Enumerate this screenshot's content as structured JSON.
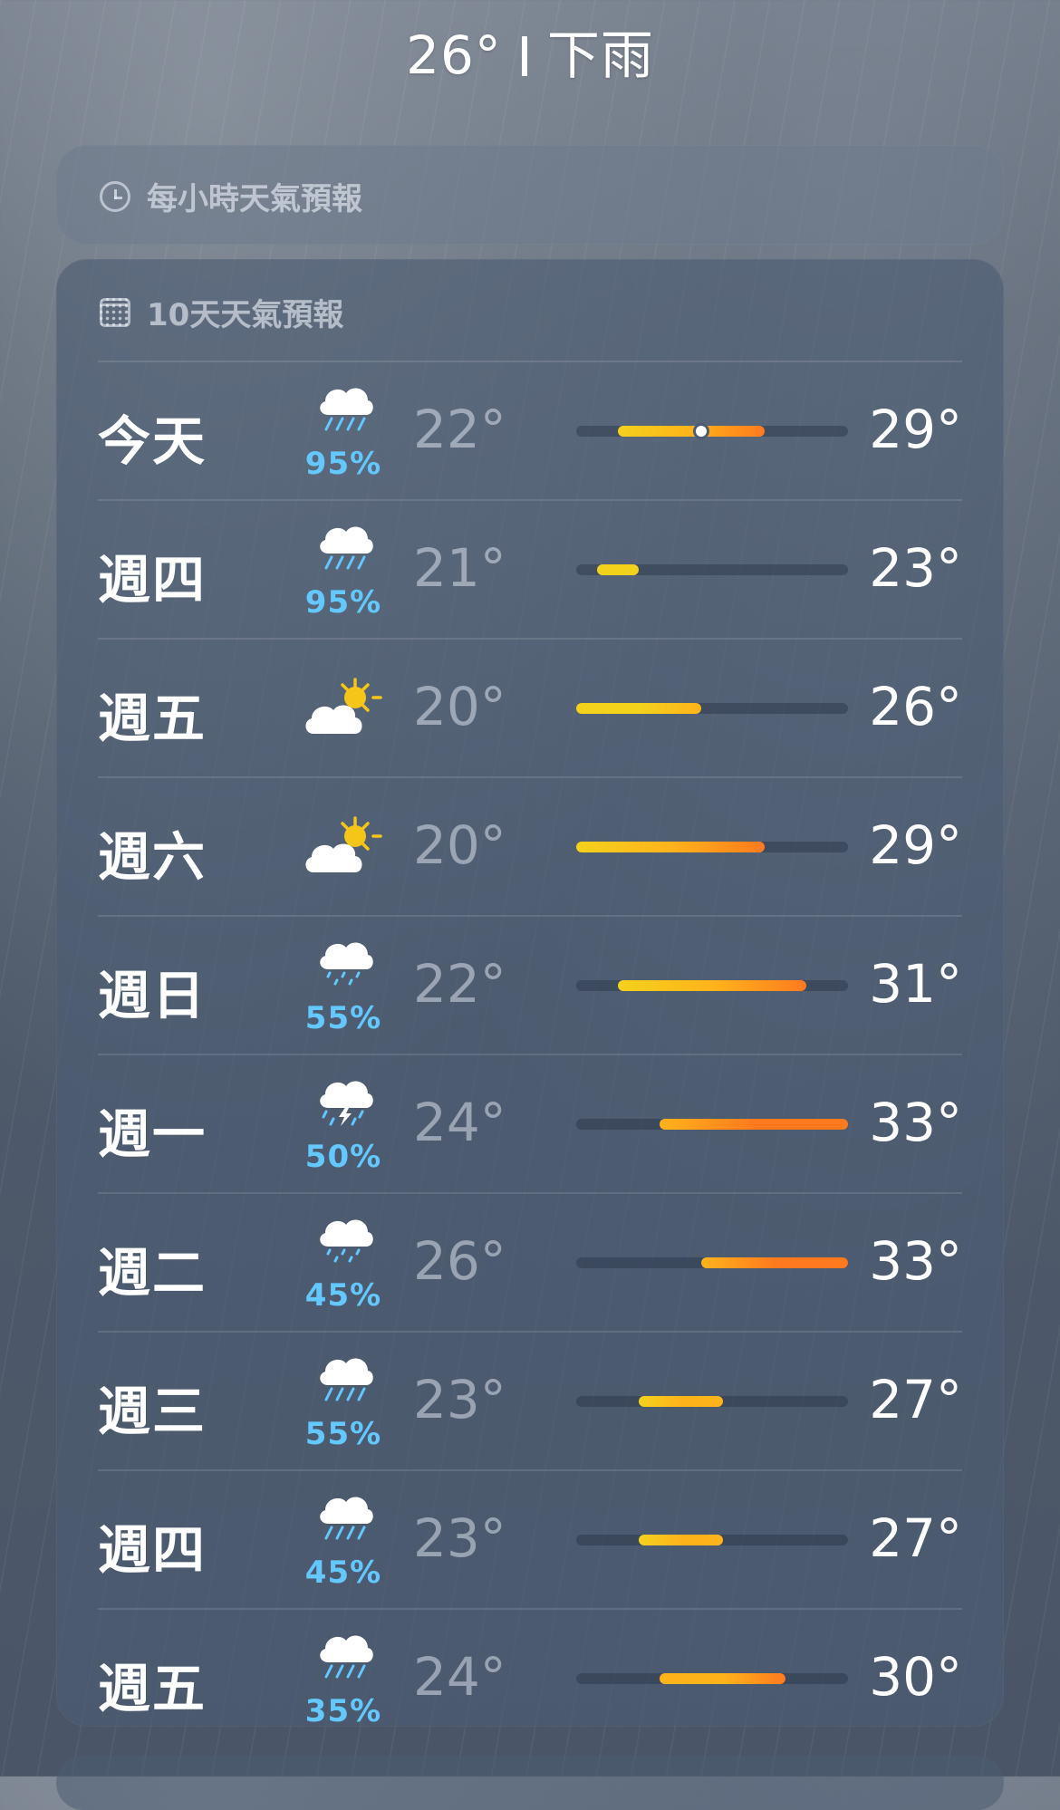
{
  "header": {
    "temperature": "26°",
    "condition": "下雨"
  },
  "hourly": {
    "label": "每小時天氣預報",
    "icon": "clock-icon"
  },
  "ten_day": {
    "label": "10天天氣預報",
    "icon": "calendar-icon",
    "scale_min": 20,
    "scale_max": 33,
    "current_temperature": 26,
    "rows": [
      {
        "day": "今天",
        "icon": "cloud-rain-icon",
        "pop": "95%",
        "low_label": "22°",
        "high_label": "29°",
        "low": 22,
        "high": 29,
        "now": true
      },
      {
        "day": "週四",
        "icon": "cloud-rain-icon",
        "pop": "95%",
        "low_label": "21°",
        "high_label": "23°",
        "low": 21,
        "high": 23
      },
      {
        "day": "週五",
        "icon": "cloud-sun-icon",
        "pop": "",
        "low_label": "20°",
        "high_label": "26°",
        "low": 20,
        "high": 26
      },
      {
        "day": "週六",
        "icon": "cloud-sun-icon",
        "pop": "",
        "low_label": "20°",
        "high_label": "29°",
        "low": 20,
        "high": 29
      },
      {
        "day": "週日",
        "icon": "cloud-drizzle-icon",
        "pop": "55%",
        "low_label": "22°",
        "high_label": "31°",
        "low": 22,
        "high": 31
      },
      {
        "day": "週一",
        "icon": "cloud-thunderstorm-icon",
        "pop": "50%",
        "low_label": "24°",
        "high_label": "33°",
        "low": 24,
        "high": 33
      },
      {
        "day": "週二",
        "icon": "cloud-drizzle-icon",
        "pop": "45%",
        "low_label": "26°",
        "high_label": "33°",
        "low": 26,
        "high": 33
      },
      {
        "day": "週三",
        "icon": "cloud-rain-icon",
        "pop": "55%",
        "low_label": "23°",
        "high_label": "27°",
        "low": 23,
        "high": 27
      },
      {
        "day": "週四",
        "icon": "cloud-rain-icon",
        "pop": "45%",
        "low_label": "23°",
        "high_label": "27°",
        "low": 23,
        "high": 27
      },
      {
        "day": "週五",
        "icon": "cloud-rain-icon",
        "pop": "35%",
        "low_label": "24°",
        "high_label": "30°",
        "low": 24,
        "high": 30
      }
    ]
  },
  "colors": {
    "precip": "#62c8ff",
    "cool": "#f3d21c",
    "mid": "#ffb31b",
    "warm": "#ff7a1e"
  }
}
